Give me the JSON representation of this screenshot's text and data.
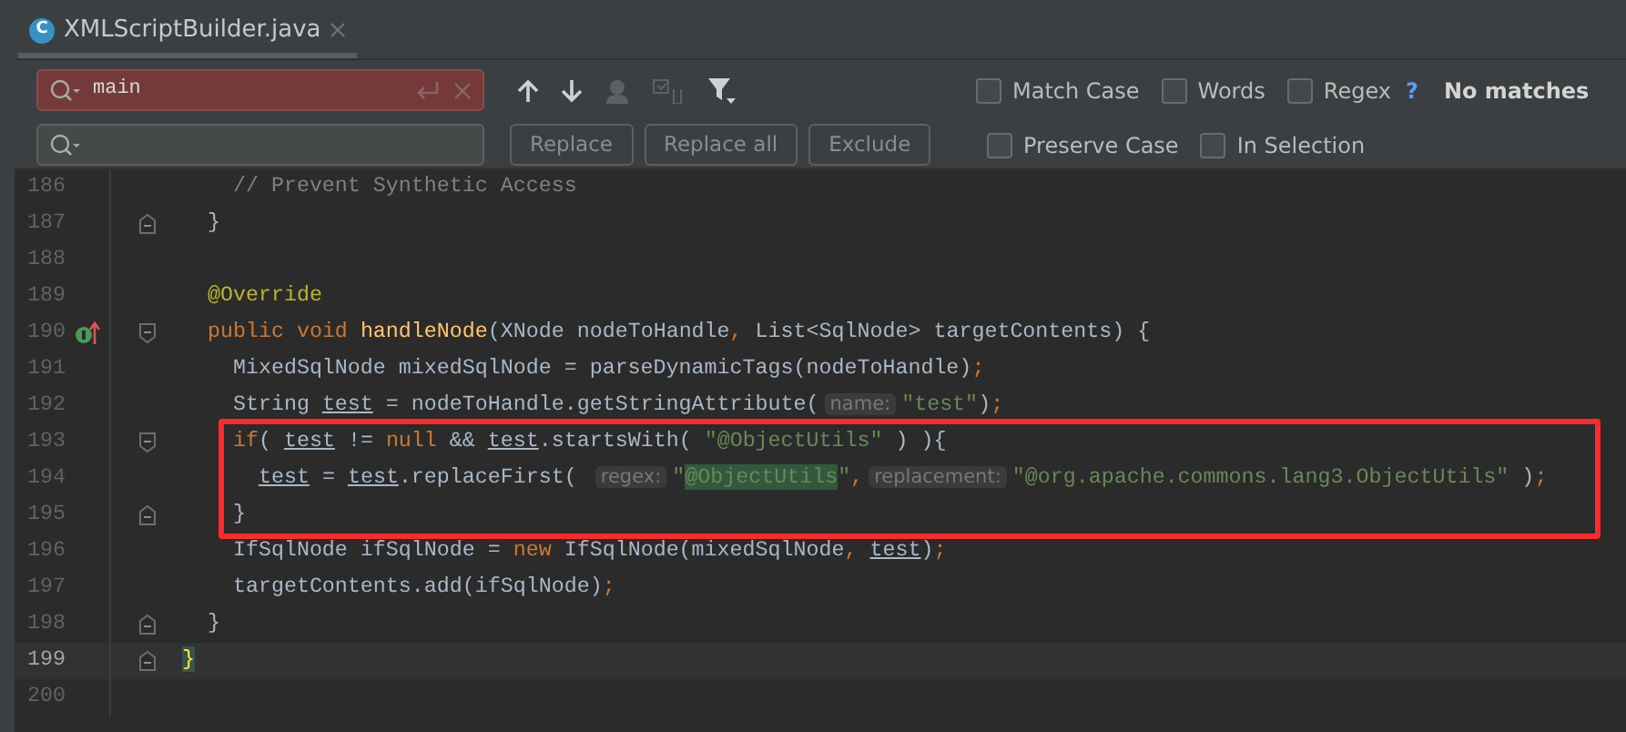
{
  "tab": {
    "icon_letter": "C",
    "title": "XMLScriptBuilder.java",
    "selected": true
  },
  "find_bar": {
    "search": {
      "value": "main",
      "error": true
    },
    "buttons": [
      "Replace",
      "Replace all",
      "Exclude"
    ],
    "options_row_1": [
      {
        "label": "Match Case",
        "checked": false
      },
      {
        "label": "Words",
        "checked": false
      },
      {
        "label": "Regex",
        "checked": false
      }
    ],
    "help": "?",
    "status": "No matches",
    "options_row_2": [
      {
        "label": "Preserve Case",
        "checked": false
      },
      {
        "label": "In Selection",
        "checked": false
      }
    ]
  },
  "editor": {
    "lines": [
      {
        "number": "186",
        "tokens": [
          {
            "text": "    // Prevent Synthetic Access",
            "kind": "comment"
          }
        ]
      },
      {
        "number": "187",
        "fold_end": true,
        "tokens": [
          {
            "text": "  }",
            "kind": "plain"
          }
        ]
      },
      {
        "number": "188"
      },
      {
        "number": "189",
        "tokens": [
          {
            "text": "  @Override",
            "kind": "annotation"
          }
        ]
      },
      {
        "number": "190",
        "fold_start": true,
        "override_marker": true,
        "tokens": [
          {
            "text": "  public void ",
            "kind": "keyword"
          },
          {
            "text": "handleNode",
            "kind": "decl"
          },
          {
            "text": "(XNode nodeToHandle",
            "kind": "plain"
          },
          {
            "text": ",",
            "kind": "keyword"
          },
          {
            "text": " List<SqlNode> targetContents) {",
            "kind": "plain"
          }
        ]
      },
      {
        "number": "191",
        "tokens": [
          {
            "text": "    MixedSqlNode mixedSqlNode = parseDynamicTags(nodeToHandle)",
            "kind": "plain"
          },
          {
            "text": ";",
            "kind": "keyword"
          }
        ]
      },
      {
        "number": "192",
        "tokens": [
          {
            "text": "    String ",
            "kind": "plain"
          },
          {
            "text": "test",
            "kind": "var"
          },
          {
            "text": " = nodeToHandle.getStringAttribute(",
            "kind": "plain"
          },
          {
            "text": "name:",
            "kind": "hint"
          },
          {
            "text": "\"test\"",
            "kind": "string"
          },
          {
            "text": ")",
            "kind": "plain"
          },
          {
            "text": ";",
            "kind": "keyword"
          }
        ]
      },
      {
        "number": "193",
        "fold_start": true,
        "boxed": true,
        "tokens": [
          {
            "text": "    if",
            "kind": "keyword"
          },
          {
            "text": "( ",
            "kind": "plain"
          },
          {
            "text": "test",
            "kind": "var"
          },
          {
            "text": " != ",
            "kind": "plain"
          },
          {
            "text": "null",
            "kind": "keyword"
          },
          {
            "text": " && ",
            "kind": "plain"
          },
          {
            "text": "test",
            "kind": "var"
          },
          {
            "text": ".startsWith( ",
            "kind": "plain"
          },
          {
            "text": "\"@ObjectUtils\"",
            "kind": "string"
          },
          {
            "text": " ) ){",
            "kind": "plain"
          }
        ]
      },
      {
        "number": "194",
        "boxed": true,
        "tokens": [
          {
            "text": "      test",
            "kind": "var"
          },
          {
            "text": " = ",
            "kind": "plain"
          },
          {
            "text": "test",
            "kind": "var"
          },
          {
            "text": ".replaceFirst( ",
            "kind": "plain"
          },
          {
            "text": "regex:",
            "kind": "hint"
          },
          {
            "text": "\"",
            "kind": "string"
          },
          {
            "text": "@ObjectUtils",
            "kind": "match"
          },
          {
            "text": "\"",
            "kind": "string"
          },
          {
            "text": ",",
            "kind": "keyword"
          },
          {
            "text": "replacement:",
            "kind": "hint"
          },
          {
            "text": "\"@org.apache.commons.lang3.ObjectUtils\"",
            "kind": "string"
          },
          {
            "text": " )",
            "kind": "plain"
          },
          {
            "text": ";",
            "kind": "keyword"
          }
        ]
      },
      {
        "number": "195",
        "fold_end": true,
        "boxed": true,
        "tokens": [
          {
            "text": "    }",
            "kind": "plain"
          }
        ]
      },
      {
        "number": "196",
        "tokens": [
          {
            "text": "    IfSqlNode ifSqlNode = ",
            "kind": "plain"
          },
          {
            "text": "new",
            "kind": "keyword"
          },
          {
            "text": " IfSqlNode(mixedSqlNode",
            "kind": "plain"
          },
          {
            "text": ", ",
            "kind": "keyword"
          },
          {
            "text": "test",
            "kind": "var"
          },
          {
            "text": ")",
            "kind": "plain"
          },
          {
            "text": ";",
            "kind": "keyword"
          }
        ]
      },
      {
        "number": "197",
        "tokens": [
          {
            "text": "    targetContents.add(ifSqlNode)",
            "kind": "plain"
          },
          {
            "text": ";",
            "kind": "keyword"
          }
        ]
      },
      {
        "number": "198",
        "fold_end": true,
        "tokens": [
          {
            "text": "  }",
            "kind": "plain"
          }
        ]
      },
      {
        "number": "199",
        "fold_end": true,
        "current": true,
        "tokens": [
          {
            "text": "}",
            "kind": "brace_match"
          }
        ]
      },
      {
        "number": "200"
      }
    ]
  }
}
